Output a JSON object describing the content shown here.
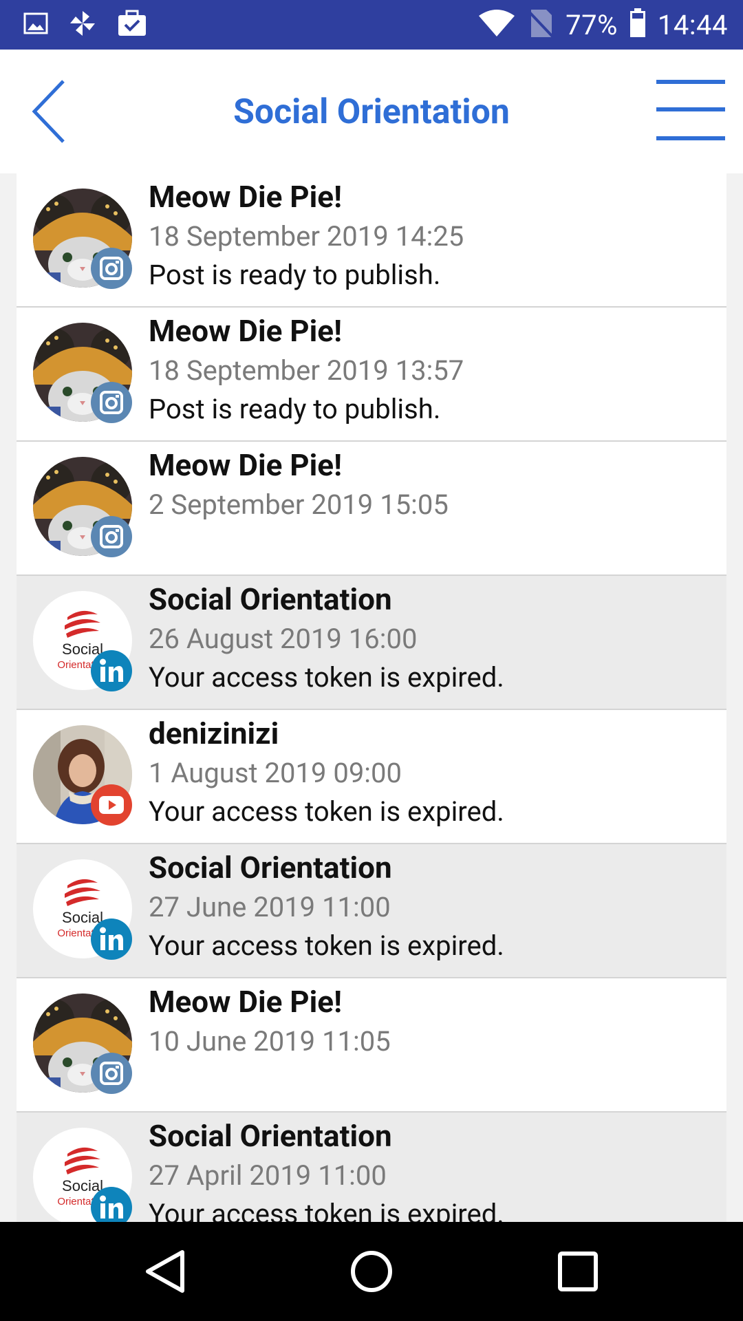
{
  "status_bar": {
    "battery": "77%",
    "time": "14:44"
  },
  "header": {
    "title": "Social Orientation"
  },
  "colors": {
    "status_bar": "#2f3f9f",
    "accent": "#2f6ed6",
    "instagram_badge": "#5b87b3",
    "linkedin_badge": "#0e84bb",
    "youtube_badge": "#e2432f"
  },
  "logo_text": {
    "line1": "Social",
    "line2": "Orientation"
  },
  "notifications": [
    {
      "name": "Meow Die Pie!",
      "date": "18 September 2019 14:25",
      "message": "Post is ready to publish.",
      "network": "instagram",
      "avatar": "cat",
      "shaded": false
    },
    {
      "name": "Meow Die Pie!",
      "date": "18 September 2019 13:57",
      "message": "Post is ready to publish.",
      "network": "instagram",
      "avatar": "cat",
      "shaded": false
    },
    {
      "name": "Meow Die Pie!",
      "date": "2 September 2019 15:05",
      "message": "",
      "network": "instagram",
      "avatar": "cat",
      "shaded": false
    },
    {
      "name": "Social Orientation",
      "date": "26 August 2019 16:00",
      "message": "Your access token is expired.",
      "network": "linkedin",
      "avatar": "logo",
      "shaded": true
    },
    {
      "name": "denizinizi",
      "date": "1 August 2019 09:00",
      "message": "Your access token is expired.",
      "network": "youtube",
      "avatar": "person",
      "shaded": false
    },
    {
      "name": "Social Orientation",
      "date": "27 June 2019 11:00",
      "message": "Your access token is expired.",
      "network": "linkedin",
      "avatar": "logo",
      "shaded": true
    },
    {
      "name": "Meow Die Pie!",
      "date": "10 June 2019 11:05",
      "message": "",
      "network": "instagram",
      "avatar": "cat",
      "shaded": false
    },
    {
      "name": "Social Orientation",
      "date": "27 April 2019 11:00",
      "message": "Your access token is expired.",
      "network": "linkedin",
      "avatar": "logo",
      "shaded": true
    }
  ]
}
